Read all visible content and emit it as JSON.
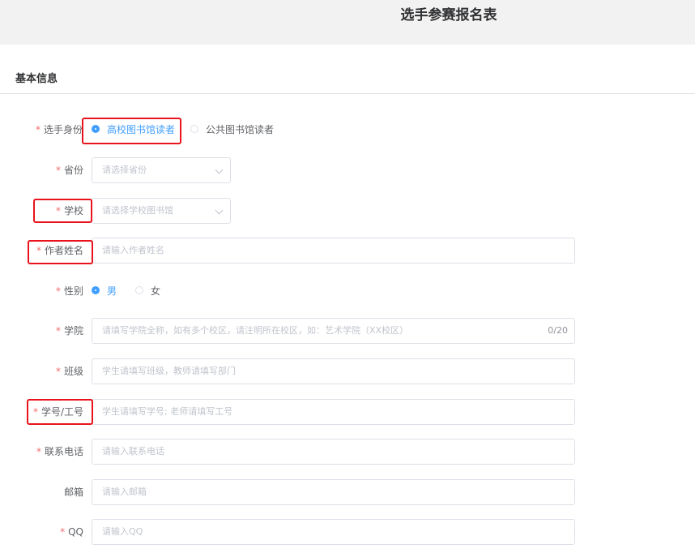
{
  "header": {
    "title": "选手参赛报名表"
  },
  "section": {
    "title": "基本信息"
  },
  "required_mark": "*",
  "form": {
    "identity": {
      "label": "选手身份",
      "options": [
        "高校图书馆读者",
        "公共图书馆读者"
      ],
      "selected": "高校图书馆读者"
    },
    "province": {
      "label": "省份",
      "placeholder": "请选择省份"
    },
    "school": {
      "label": "学校",
      "placeholder": "请选择学校图书馆"
    },
    "author_name": {
      "label": "作者姓名",
      "placeholder": "请输入作者姓名"
    },
    "gender": {
      "label": "性别",
      "options": [
        "男",
        "女"
      ],
      "selected": "男"
    },
    "college": {
      "label": "学院",
      "placeholder": "请填写学院全称，如有多个校区，请注明所在校区，如：艺术学院（XX校区）",
      "counter": "0/20"
    },
    "class": {
      "label": "班级",
      "placeholder": "学生请填写班级，教师请填写部门"
    },
    "student_id": {
      "label": "学号/工号",
      "placeholder": "学生请填写学号; 老师请填写工号"
    },
    "phone": {
      "label": "联系电话",
      "placeholder": "请输入联系电话"
    },
    "email": {
      "label": "邮箱",
      "placeholder": "请输入邮箱"
    },
    "qq": {
      "label": "QQ",
      "placeholder": "请输入QQ"
    }
  },
  "colors": {
    "primary": "#409eff",
    "required": "#f56c6c",
    "highlight": "#e8131c",
    "header_bg": "#f2f2f2"
  }
}
